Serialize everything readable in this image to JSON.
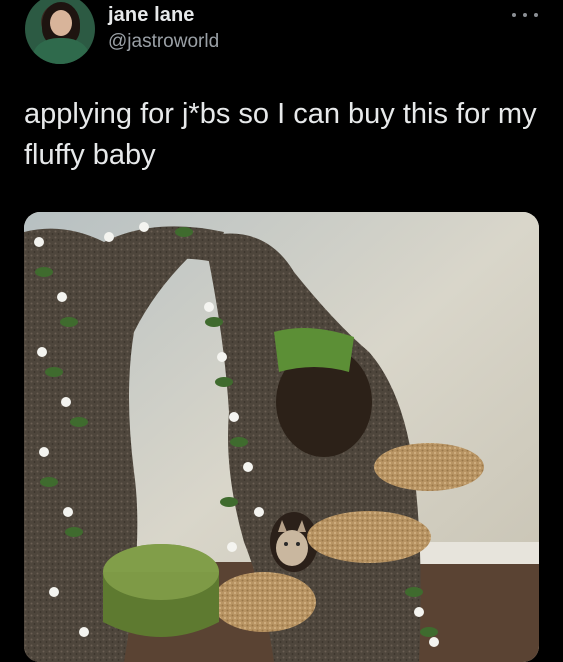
{
  "author": {
    "display_name": "jane lane",
    "handle": "@jastroworld",
    "avatar_icon": "profile-avatar"
  },
  "header": {
    "more_icon": "more-options-icon"
  },
  "tweet": {
    "text": "applying for j*bs so I can buy this for my fluffy baby"
  },
  "media": {
    "icon": "cat-tree-photo"
  }
}
